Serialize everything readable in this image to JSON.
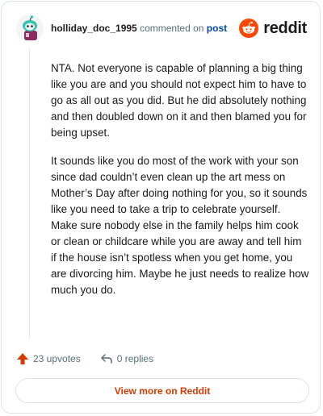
{
  "header": {
    "username": "holliday_doc_1995",
    "action_text": "commented on",
    "post_link": "post",
    "brand_name": "reddit"
  },
  "comment": {
    "paragraphs": [
      "NTA. Not everyone is capable of planning a big thing like you are and you should not expect him to have to go as all out as you did. But he did absolutely nothing and then doubled down on it and then blamed you for being upset.",
      "It sounds like you do most of the work with your son since dad couldn’t even clean up the art mess on Mother’s Day after doing nothing for you, so it sounds like you need to take a trip to celebrate yourself. Make sure nobody else in the family helps him cook or clean or childcare while you are away and tell him if the house isn’t spotless when you get home, you are divorcing him. Maybe he just needs to realize how much you do."
    ]
  },
  "actions": {
    "upvotes": "23 upvotes",
    "replies": "0 replies"
  },
  "footer": {
    "view_more": "View more on Reddit"
  },
  "colors": {
    "accent": "#d93a00",
    "reddit_orange": "#ff4500",
    "link_blue": "#0045ac",
    "avatar_teal": "#35c2b0"
  },
  "icons": [
    "avatar",
    "reddit-logo-icon",
    "upvote-icon",
    "reply-icon"
  ]
}
